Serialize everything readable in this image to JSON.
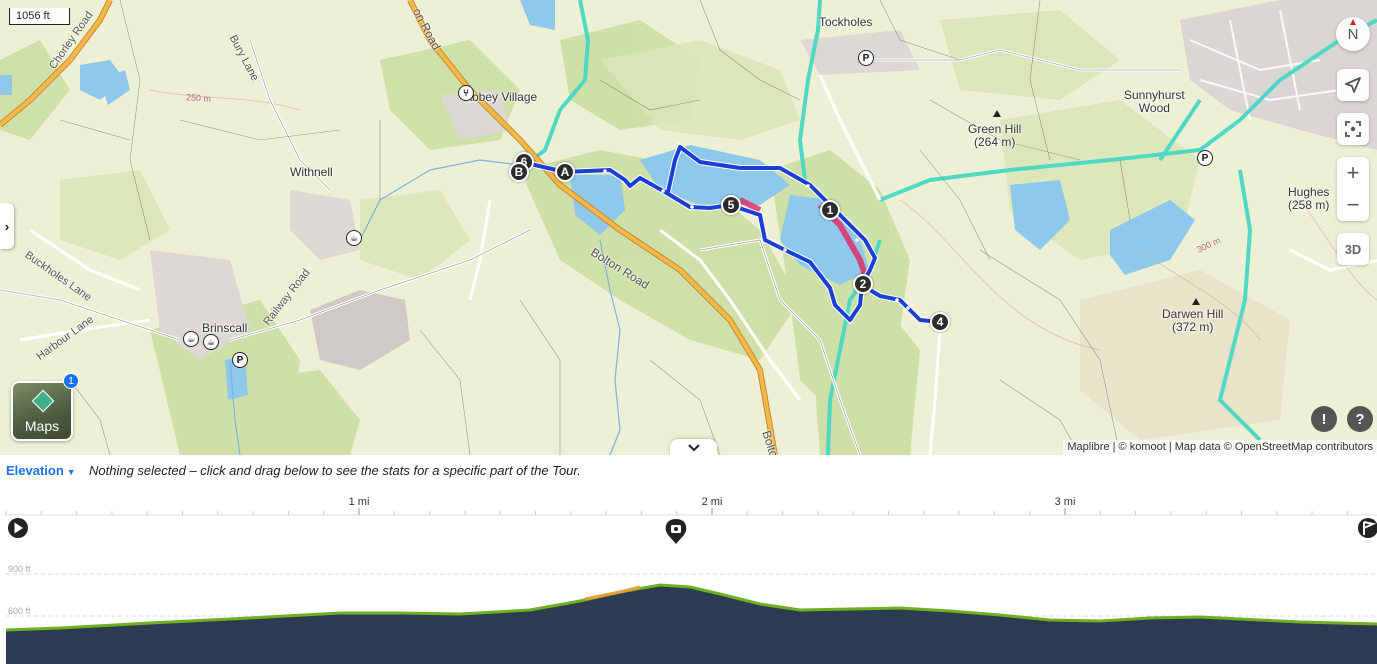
{
  "map": {
    "scale_label": "1056 ft",
    "place_labels": {
      "tockholes": "Tockholes",
      "abbey_village": "Abbey Village",
      "withnell": "Withnell",
      "brinscall": "Brinscall",
      "sunnyhurst_wood": "Sunnyhurst\nWood",
      "green_hill": "Green Hill\n(264 m)",
      "darwen_hill": "Darwen Hill\n(372 m)",
      "hughes": "Hughes\n(258 m)"
    },
    "road_labels": {
      "chorley_road": "Chorley Road",
      "bury_lane": "Bury Lane",
      "buckholes_lane": "Buckholes Lane",
      "harbour_lane": "Harbour Lane",
      "railway_road": "Railway Road",
      "bolton_road": "Bolton Road",
      "bolton_road_2": "Bolton",
      "on_road": "on Road"
    },
    "contour_labels": {
      "c1": "250 m",
      "c2": "300 m"
    },
    "waypoints": [
      "1",
      "2",
      "4",
      "5",
      "6",
      "A",
      "B"
    ],
    "poi_parking": "P",
    "controls": {
      "compass_label": "N",
      "three_d_label": "3D",
      "zoom_in": "+",
      "zoom_out": "−",
      "report_label": "!",
      "help_label": "?"
    },
    "maps_button_label": "Maps",
    "maps_badge": "1",
    "attribution": "Maplibre | © komoot | Map data © OpenStreetMap contributors",
    "icons": {
      "locate": "location-arrow-icon",
      "fit": "fit-bounds-icon",
      "sidebar_toggle": "chevron-right-icon",
      "collapse": "chevron-down-icon",
      "restaurant": "fork-knife-icon",
      "cafe": "cafe-icon"
    },
    "colors": {
      "route": "#1a3fd6",
      "river": "#4fd8c4",
      "water": "#8ec8ea",
      "main_road": "#f2b84b"
    }
  },
  "elevation": {
    "dropdown_label": "Elevation",
    "hint": "Nothing selected – click and drag below to see the stats for a specific part of the Tour.",
    "distance_ticks": [
      "1 mi",
      "2 mi",
      "3 mi"
    ],
    "y_ticks": [
      "900 ft",
      "600 ft"
    ],
    "icons": {
      "start": "play-icon",
      "waypoint_marker": "photo-pin-icon",
      "finish": "flag-icon"
    },
    "colors": {
      "profile_fill": "#2c3a52",
      "profile_line": "#6fb021",
      "highlight": "#e8a03a"
    }
  }
}
